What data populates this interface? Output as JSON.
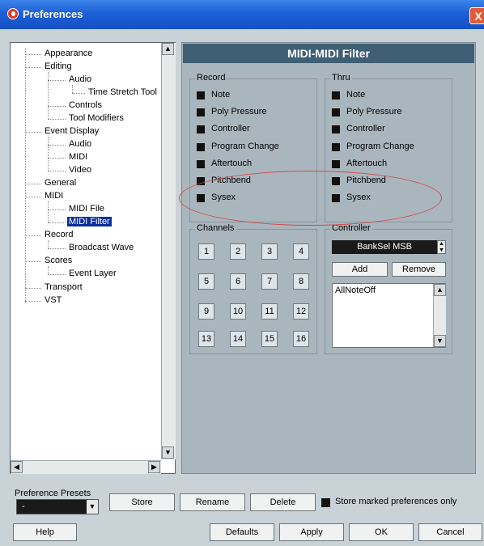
{
  "window": {
    "title": "Preferences",
    "close_label": "X"
  },
  "tree": {
    "items": [
      {
        "label": "Appearance"
      },
      {
        "label": "Editing"
      },
      {
        "label": "Audio"
      },
      {
        "label": "Time Stretch Tool"
      },
      {
        "label": "Controls"
      },
      {
        "label": "Tool Modifiers"
      },
      {
        "label": "Event Display"
      },
      {
        "label": "Audio"
      },
      {
        "label": "MIDI"
      },
      {
        "label": "Video"
      },
      {
        "label": "General"
      },
      {
        "label": "MIDI"
      },
      {
        "label": "MIDI File"
      },
      {
        "label": "MIDI Filter"
      },
      {
        "label": "Record"
      },
      {
        "label": "Broadcast Wave"
      },
      {
        "label": "Scores"
      },
      {
        "label": "Event Layer"
      },
      {
        "label": "Transport"
      },
      {
        "label": "VST"
      }
    ],
    "selected": "MIDI Filter"
  },
  "panel": {
    "title": "MIDI-MIDI Filter",
    "record": {
      "label": "Record",
      "items": [
        "Note",
        "Poly Pressure",
        "Controller",
        "Program Change",
        "Aftertouch",
        "Pitchbend",
        "Sysex"
      ]
    },
    "thru": {
      "label": "Thru",
      "items": [
        "Note",
        "Poly Pressure",
        "Controller",
        "Program Change",
        "Aftertouch",
        "Pitchbend",
        "Sysex"
      ]
    },
    "channels": {
      "label": "Channels",
      "buttons": [
        "1",
        "2",
        "3",
        "4",
        "5",
        "6",
        "7",
        "8",
        "9",
        "10",
        "11",
        "12",
        "13",
        "14",
        "15",
        "16"
      ]
    },
    "controller": {
      "label": "Controller",
      "selected": "BankSel MSB",
      "add_label": "Add",
      "remove_label": "Remove",
      "list": [
        "AllNoteOff"
      ]
    }
  },
  "bottom": {
    "presets_label": "Preference Presets",
    "preset_value": "-",
    "store_label": "Store",
    "rename_label": "Rename",
    "delete_label": "Delete",
    "store_marked_label": "Store marked preferences only",
    "help_label": "Help",
    "defaults_label": "Defaults",
    "apply_label": "Apply",
    "ok_label": "OK",
    "cancel_label": "Cancel"
  },
  "colors": {
    "accent": "#3e5f74",
    "annotation": "#d04a4a",
    "selection": "#0a2f9c"
  }
}
